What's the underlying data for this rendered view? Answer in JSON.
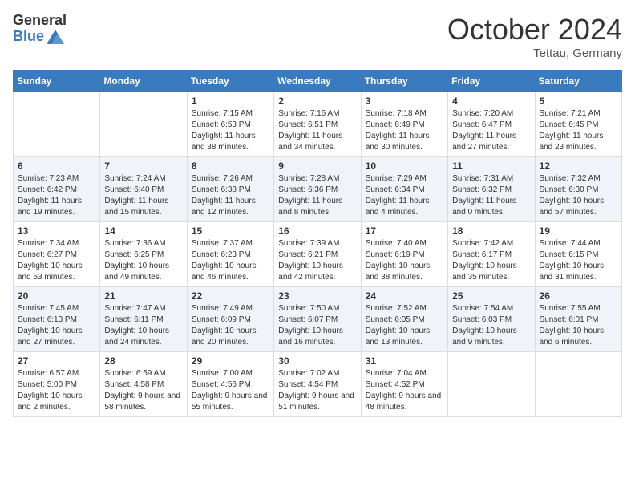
{
  "header": {
    "logo_general": "General",
    "logo_blue": "Blue",
    "month_year": "October 2024",
    "location": "Tettau, Germany"
  },
  "days_of_week": [
    "Sunday",
    "Monday",
    "Tuesday",
    "Wednesday",
    "Thursday",
    "Friday",
    "Saturday"
  ],
  "weeks": [
    [
      {
        "day": "",
        "info": ""
      },
      {
        "day": "",
        "info": ""
      },
      {
        "day": "1",
        "info": "Sunrise: 7:15 AM\nSunset: 6:53 PM\nDaylight: 11 hours and 38 minutes."
      },
      {
        "day": "2",
        "info": "Sunrise: 7:16 AM\nSunset: 6:51 PM\nDaylight: 11 hours and 34 minutes."
      },
      {
        "day": "3",
        "info": "Sunrise: 7:18 AM\nSunset: 6:49 PM\nDaylight: 11 hours and 30 minutes."
      },
      {
        "day": "4",
        "info": "Sunrise: 7:20 AM\nSunset: 6:47 PM\nDaylight: 11 hours and 27 minutes."
      },
      {
        "day": "5",
        "info": "Sunrise: 7:21 AM\nSunset: 6:45 PM\nDaylight: 11 hours and 23 minutes."
      }
    ],
    [
      {
        "day": "6",
        "info": "Sunrise: 7:23 AM\nSunset: 6:42 PM\nDaylight: 11 hours and 19 minutes."
      },
      {
        "day": "7",
        "info": "Sunrise: 7:24 AM\nSunset: 6:40 PM\nDaylight: 11 hours and 15 minutes."
      },
      {
        "day": "8",
        "info": "Sunrise: 7:26 AM\nSunset: 6:38 PM\nDaylight: 11 hours and 12 minutes."
      },
      {
        "day": "9",
        "info": "Sunrise: 7:28 AM\nSunset: 6:36 PM\nDaylight: 11 hours and 8 minutes."
      },
      {
        "day": "10",
        "info": "Sunrise: 7:29 AM\nSunset: 6:34 PM\nDaylight: 11 hours and 4 minutes."
      },
      {
        "day": "11",
        "info": "Sunrise: 7:31 AM\nSunset: 6:32 PM\nDaylight: 11 hours and 0 minutes."
      },
      {
        "day": "12",
        "info": "Sunrise: 7:32 AM\nSunset: 6:30 PM\nDaylight: 10 hours and 57 minutes."
      }
    ],
    [
      {
        "day": "13",
        "info": "Sunrise: 7:34 AM\nSunset: 6:27 PM\nDaylight: 10 hours and 53 minutes."
      },
      {
        "day": "14",
        "info": "Sunrise: 7:36 AM\nSunset: 6:25 PM\nDaylight: 10 hours and 49 minutes."
      },
      {
        "day": "15",
        "info": "Sunrise: 7:37 AM\nSunset: 6:23 PM\nDaylight: 10 hours and 46 minutes."
      },
      {
        "day": "16",
        "info": "Sunrise: 7:39 AM\nSunset: 6:21 PM\nDaylight: 10 hours and 42 minutes."
      },
      {
        "day": "17",
        "info": "Sunrise: 7:40 AM\nSunset: 6:19 PM\nDaylight: 10 hours and 38 minutes."
      },
      {
        "day": "18",
        "info": "Sunrise: 7:42 AM\nSunset: 6:17 PM\nDaylight: 10 hours and 35 minutes."
      },
      {
        "day": "19",
        "info": "Sunrise: 7:44 AM\nSunset: 6:15 PM\nDaylight: 10 hours and 31 minutes."
      }
    ],
    [
      {
        "day": "20",
        "info": "Sunrise: 7:45 AM\nSunset: 6:13 PM\nDaylight: 10 hours and 27 minutes."
      },
      {
        "day": "21",
        "info": "Sunrise: 7:47 AM\nSunset: 6:11 PM\nDaylight: 10 hours and 24 minutes."
      },
      {
        "day": "22",
        "info": "Sunrise: 7:49 AM\nSunset: 6:09 PM\nDaylight: 10 hours and 20 minutes."
      },
      {
        "day": "23",
        "info": "Sunrise: 7:50 AM\nSunset: 6:07 PM\nDaylight: 10 hours and 16 minutes."
      },
      {
        "day": "24",
        "info": "Sunrise: 7:52 AM\nSunset: 6:05 PM\nDaylight: 10 hours and 13 minutes."
      },
      {
        "day": "25",
        "info": "Sunrise: 7:54 AM\nSunset: 6:03 PM\nDaylight: 10 hours and 9 minutes."
      },
      {
        "day": "26",
        "info": "Sunrise: 7:55 AM\nSunset: 6:01 PM\nDaylight: 10 hours and 6 minutes."
      }
    ],
    [
      {
        "day": "27",
        "info": "Sunrise: 6:57 AM\nSunset: 5:00 PM\nDaylight: 10 hours and 2 minutes."
      },
      {
        "day": "28",
        "info": "Sunrise: 6:59 AM\nSunset: 4:58 PM\nDaylight: 9 hours and 58 minutes."
      },
      {
        "day": "29",
        "info": "Sunrise: 7:00 AM\nSunset: 4:56 PM\nDaylight: 9 hours and 55 minutes."
      },
      {
        "day": "30",
        "info": "Sunrise: 7:02 AM\nSunset: 4:54 PM\nDaylight: 9 hours and 51 minutes."
      },
      {
        "day": "31",
        "info": "Sunrise: 7:04 AM\nSunset: 4:52 PM\nDaylight: 9 hours and 48 minutes."
      },
      {
        "day": "",
        "info": ""
      },
      {
        "day": "",
        "info": ""
      }
    ]
  ]
}
